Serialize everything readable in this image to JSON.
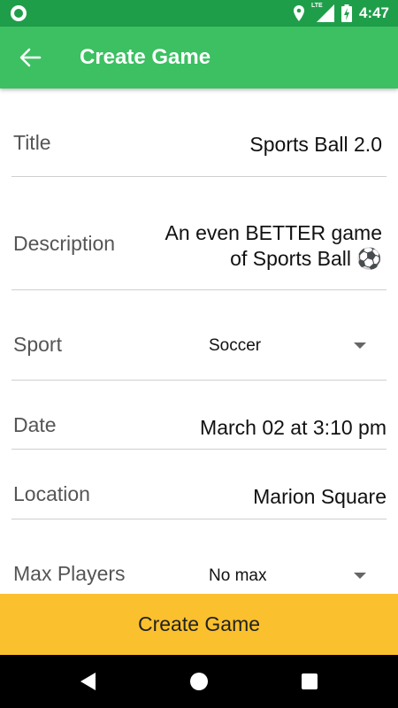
{
  "status_bar": {
    "time": "4:47",
    "network_label": "LTE",
    "icons": [
      "circle-icon",
      "location-icon",
      "signal-icon",
      "battery-charging-icon"
    ]
  },
  "app_bar": {
    "title": "Create Game",
    "back_icon": "arrow-back-icon"
  },
  "form": {
    "title": {
      "label": "Title",
      "value": "Sports Ball 2.0"
    },
    "description": {
      "label": "Description",
      "value_line1": "An even BETTER game",
      "value_line2": "of Sports Ball ⚽"
    },
    "sport": {
      "label": "Sport",
      "selected": "Soccer"
    },
    "date": {
      "label": "Date",
      "value": "March 02 at 3:10 pm"
    },
    "location": {
      "label": "Location",
      "value": "Marion Square"
    },
    "max_players": {
      "label": "Max Players",
      "selected": "No max"
    }
  },
  "create_button": {
    "label": "Create Game"
  },
  "nav_bar": {
    "icons": [
      "back-triangle-icon",
      "home-circle-icon",
      "recents-square-icon"
    ]
  },
  "colors": {
    "app_bar": "#3cc062",
    "status_bar": "#1f9e4a",
    "button": "#fbc02d",
    "nav_bar": "#000000"
  }
}
